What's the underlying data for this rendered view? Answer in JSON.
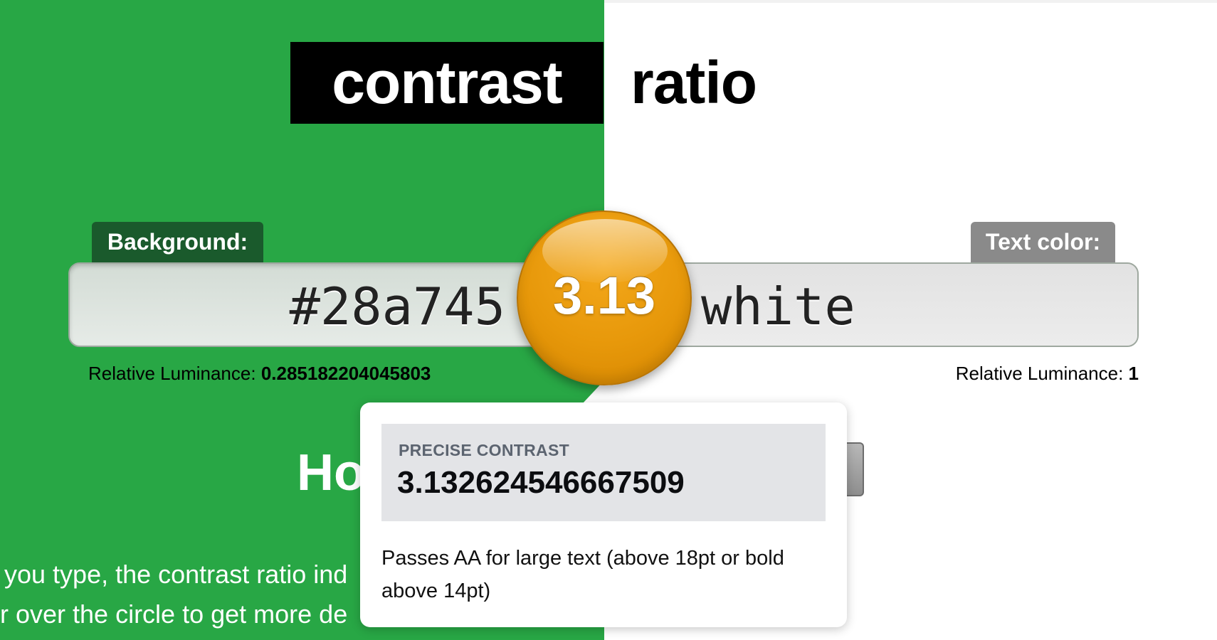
{
  "title": {
    "word1": "contrast",
    "word2": "ratio"
  },
  "background": {
    "label": "Background:",
    "value": "#28a745",
    "luminance_label": "Relative Luminance:",
    "luminance_value": "0.285182204045803",
    "color": "#28a745"
  },
  "foreground": {
    "label": "Text color:",
    "value": "white",
    "luminance_label": "Relative Luminance:",
    "luminance_value": "1",
    "color": "#ffffff"
  },
  "ratio": {
    "value": "3.13"
  },
  "tooltip": {
    "precise_label": "PRECISE CONTRAST",
    "precise_value": "3.132624546667509",
    "note": "Passes AA for large text (above 18pt or bold above 14pt)"
  },
  "section": {
    "heading_partial": "Ho",
    "line1_partial": "you type, the contrast ratio ind",
    "line2_partial": "r over the circle to get more de"
  },
  "colors": {
    "accent_circle": "#e7980a",
    "label_bg": "#1a5a2c",
    "label_fg": "#8a8a8a"
  }
}
